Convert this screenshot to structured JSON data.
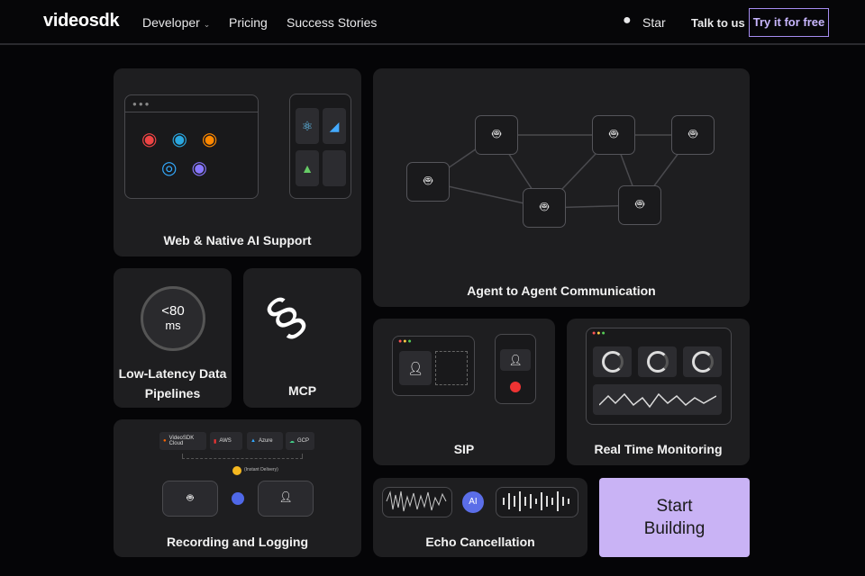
{
  "nav": {
    "logo": "videosdk",
    "developer": "Developer",
    "pricing": "Pricing",
    "stories": "Success Stories",
    "star": "Star",
    "talk": "Talk to us",
    "try": "Try it for free"
  },
  "cards": {
    "web": "Web & Native AI Support",
    "agent": "Agent to Agent Communication",
    "latency_value": "<80",
    "latency_unit": "ms",
    "latency": "Low-Latency Data Pipelines",
    "mcp": "MCP",
    "sip": "SIP",
    "monitoring": "Real Time Monitoring",
    "recording": "Recording and Logging",
    "echo": "Echo Cancellation",
    "echo_ai": "AI",
    "start": "Start Building"
  },
  "recording": {
    "clouds": [
      "VideoSDK Cloud",
      "AWS",
      "Azure",
      "GCP"
    ],
    "instant": "(Instant Delivery)"
  },
  "colors": {
    "accent": "#c9b3f5",
    "border": "#a58cf0"
  }
}
